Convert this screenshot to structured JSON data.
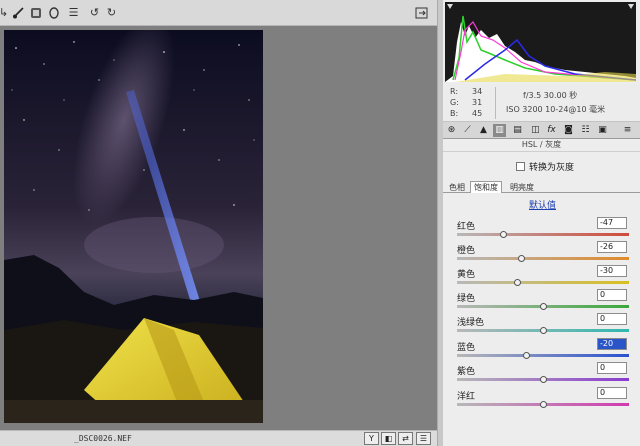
{
  "filename": "_DSC0026.NEF",
  "histogram": {
    "r": {
      "label": "R:",
      "value": "34"
    },
    "g": {
      "label": "G:",
      "value": "31"
    },
    "b": {
      "label": "B:",
      "value": "45"
    },
    "exif_line1": "f/3.5   30.00 秒",
    "exif_line2": "ISO 3200   10-24@10 毫米"
  },
  "panel": {
    "section_title": "HSL / 灰度",
    "grayscale_label": "转换为灰度",
    "subtabs": [
      "色相",
      "饱和度",
      "明亮度"
    ],
    "default_link": "默认值"
  },
  "sliders": [
    {
      "label": "红色",
      "value": "-47",
      "level": -47,
      "gradient": [
        "#b8b8b8",
        "#d04a3a"
      ]
    },
    {
      "label": "橙色",
      "value": "-26",
      "level": -26,
      "gradient": [
        "#b8b8b8",
        "#e08a2a"
      ]
    },
    {
      "label": "黄色",
      "value": "-30",
      "level": -30,
      "gradient": [
        "#b8b8b8",
        "#d8c020"
      ]
    },
    {
      "label": "绿色",
      "value": "0",
      "level": 0,
      "gradient": [
        "#b8b8b8",
        "#3aa83a"
      ]
    },
    {
      "label": "浅绿色",
      "value": "0",
      "level": 0,
      "gradient": [
        "#b8b8b8",
        "#30b8b0"
      ]
    },
    {
      "label": "蓝色",
      "value": "-20",
      "level": -20,
      "gradient": [
        "#b8b8b8",
        "#2a50d0"
      ]
    },
    {
      "label": "紫色",
      "value": "0",
      "level": 0,
      "gradient": [
        "#b8b8b8",
        "#8a3ad0"
      ]
    },
    {
      "label": "洋红",
      "value": "0",
      "level": 0,
      "gradient": [
        "#b8b8b8",
        "#d03ab0"
      ]
    }
  ],
  "selected_slider": 5,
  "icons": {
    "toolbar": [
      "crop-icon",
      "brush-icon",
      "gradient-filter-icon",
      "radial-filter-icon",
      "preferences-icon",
      "rotate-left-icon",
      "rotate-right-icon"
    ],
    "panel_tabs": [
      "basic-icon",
      "tone-curve-icon",
      "detail-icon",
      "hsl-icon",
      "split-toning-icon",
      "lens-icon",
      "fx-icon",
      "camera-calibration-icon",
      "presets-icon",
      "snapshots-icon"
    ]
  }
}
